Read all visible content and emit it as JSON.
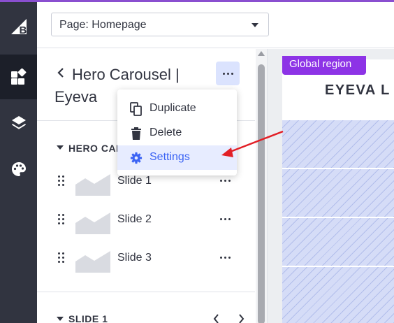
{
  "colors": {
    "rail": "#313440",
    "accent": "#3c64f4",
    "global_region": "#8d33e6",
    "annotation_arrow": "#e21f26"
  },
  "rail": {
    "items": [
      {
        "name": "bigcommerce-logo-icon",
        "active": false
      },
      {
        "name": "widgets-icon",
        "active": true
      },
      {
        "name": "layers-icon",
        "active": false
      },
      {
        "name": "palette-icon",
        "active": false
      }
    ]
  },
  "topbar": {
    "page_select_value": "Page: Homepage"
  },
  "panel": {
    "title": "Hero Carousel | Eyeva",
    "section_label": "HERO CAROUSEL",
    "slides": [
      {
        "label": "Slide 1"
      },
      {
        "label": "Slide 2"
      },
      {
        "label": "Slide 3"
      }
    ],
    "slide_section_label": "SLIDE 1"
  },
  "menu": {
    "items": [
      {
        "label": "Duplicate",
        "icon": "copy-icon"
      },
      {
        "label": "Delete",
        "icon": "trash-icon"
      },
      {
        "label": "Settings",
        "icon": "gear-icon",
        "active": true
      }
    ]
  },
  "preview": {
    "region_label": "Global region",
    "logo_text": "EYEVA L"
  }
}
